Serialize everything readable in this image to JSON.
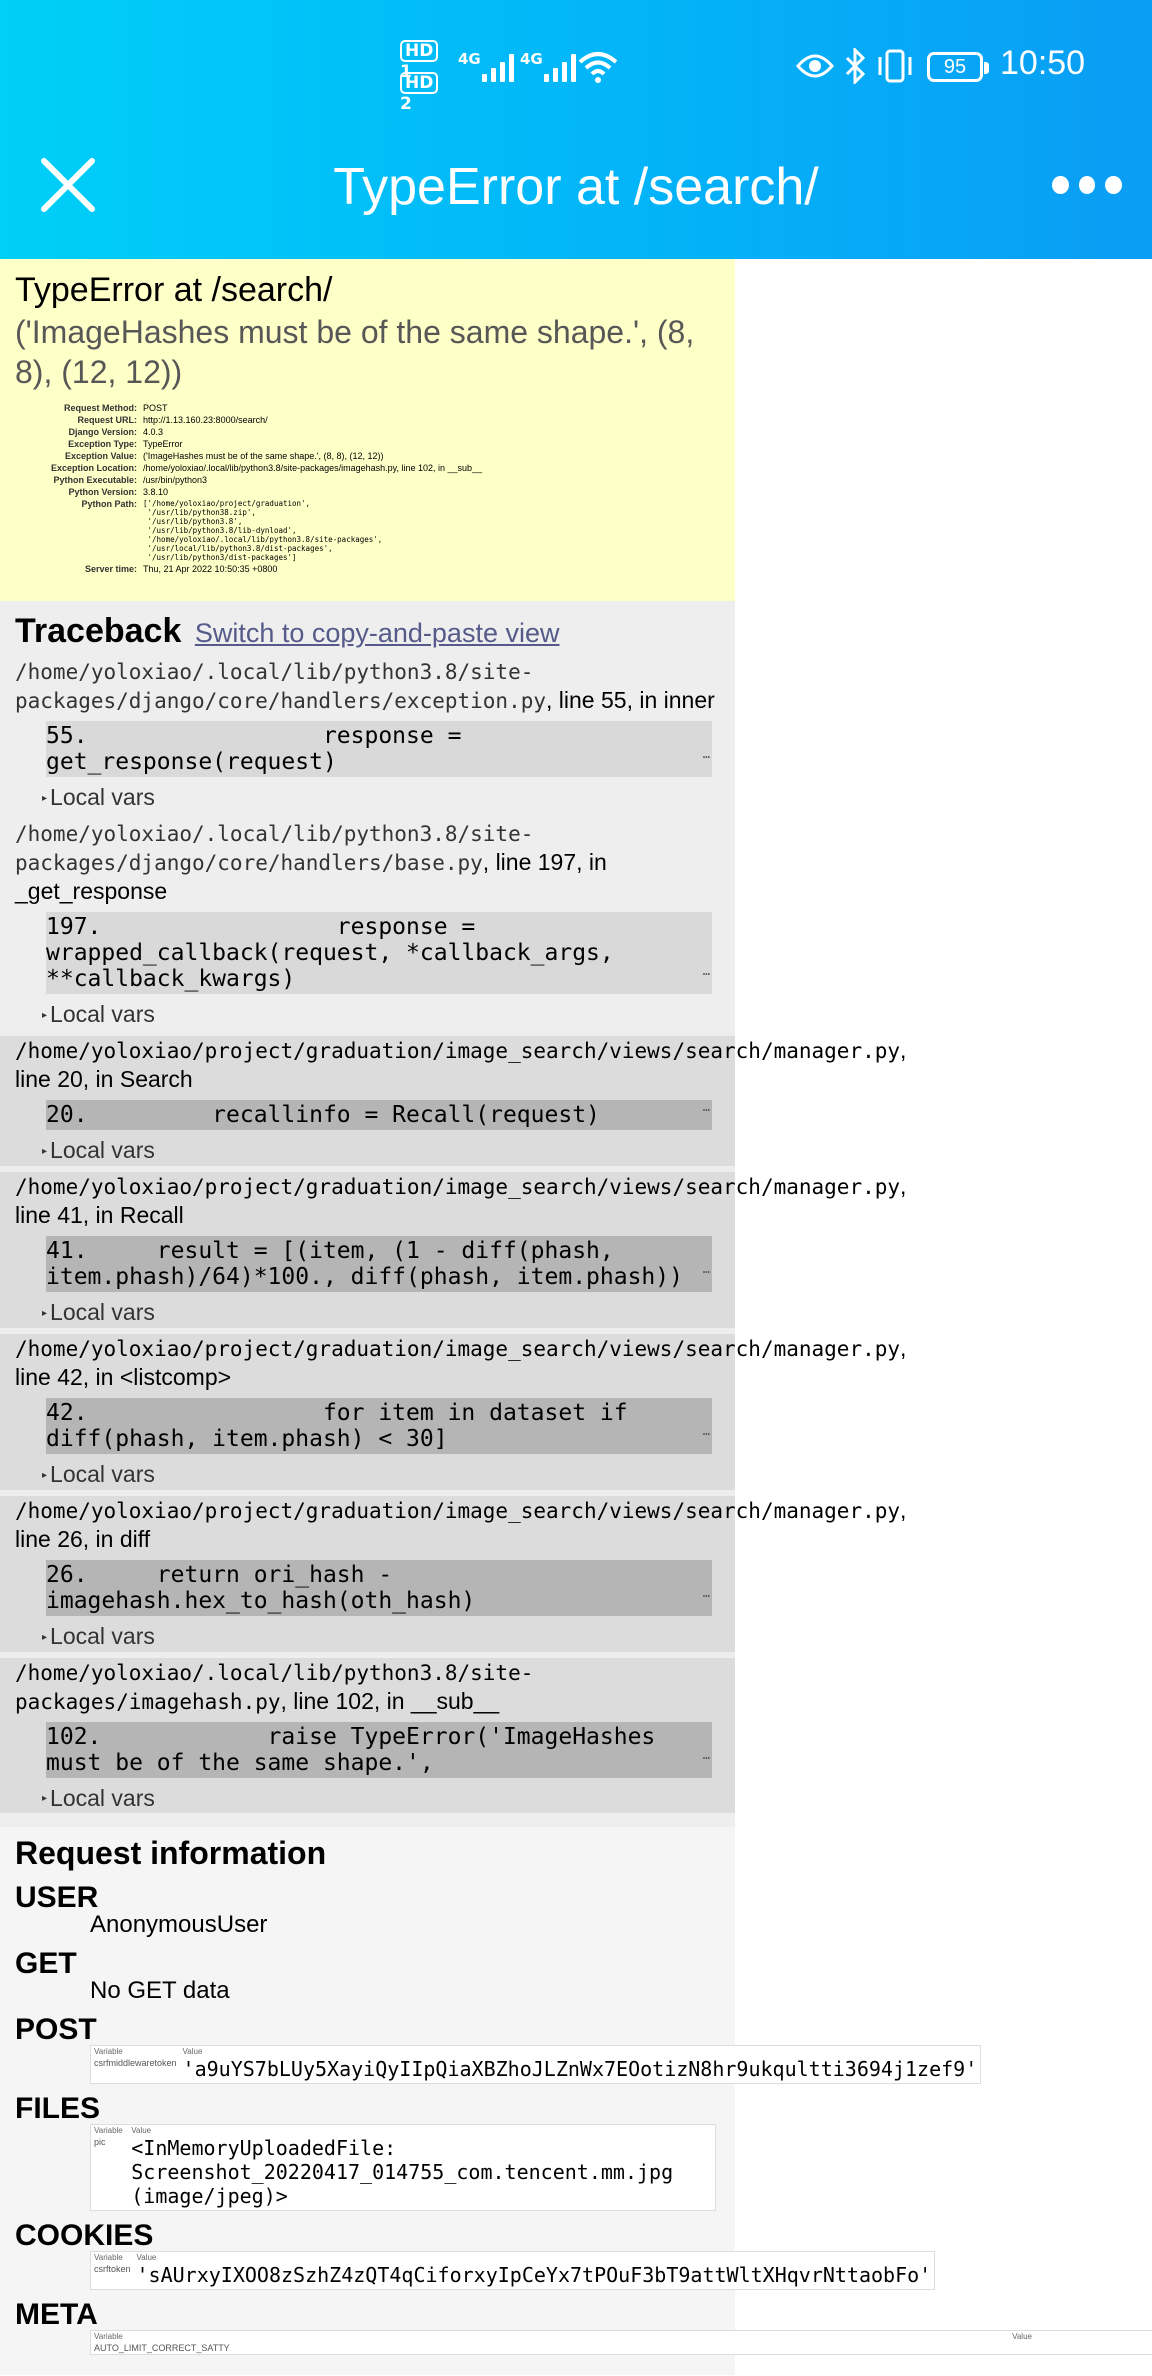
{
  "status_bar": {
    "sim1_badge": "HD",
    "sim1_num": "1",
    "sim2_badge": "HD",
    "sim2_num": "2",
    "net1": "4G",
    "net2": "4G",
    "battery": "95",
    "time": "10:50"
  },
  "nav": {
    "title": "TypeError at /search/"
  },
  "error": {
    "title": "TypeError at /search/",
    "message": "('ImageHashes must be of the same shape.', (8, 8), (12, 12))",
    "meta": [
      {
        "label": "Request Method:",
        "value": "POST"
      },
      {
        "label": "Request URL:",
        "value": "http://1.13.160.23:8000/search/"
      },
      {
        "label": "Django Version:",
        "value": "4.0.3"
      },
      {
        "label": "Exception Type:",
        "value": "TypeError"
      },
      {
        "label": "Exception Value:",
        "value": "('ImageHashes must be of the same shape.', (8, 8), (12, 12))"
      },
      {
        "label": "Exception Location:",
        "value": "/home/yoloxiao/.local/lib/python3.8/site-packages/imagehash.py, line 102, in __sub__"
      },
      {
        "label": "Python Executable:",
        "value": "/usr/bin/python3"
      },
      {
        "label": "Python Version:",
        "value": "3.8.10"
      },
      {
        "label": "Python Path:",
        "value": "['/home/yoloxiao/project/graduation',\n '/usr/lib/python38.zip',\n '/usr/lib/python3.8',\n '/usr/lib/python3.8/lib-dynload',\n '/home/yoloxiao/.local/lib/python3.8/site-packages',\n '/usr/local/lib/python3.8/dist-packages',\n '/usr/lib/python3/dist-packages']"
      },
      {
        "label": "Server time:",
        "value": "Thu, 21 Apr 2022 10:50:35 +0800"
      }
    ]
  },
  "traceback": {
    "heading": "Traceback",
    "switch_link": "Switch to copy-and-paste view",
    "local_vars_label": "Local vars",
    "frames": [
      {
        "path": "/home/yoloxiao/.local/lib/python3.8/site-packages/django/core/handlers/exception.py",
        "loc": ", line 55, in inner",
        "code": "55.                 response = get_response(request)",
        "user": false
      },
      {
        "path": "/home/yoloxiao/.local/lib/python3.8/site-packages/django/core/handlers/base.py",
        "loc": ", line 197, in _get_response",
        "code": "197.                 response = wrapped_callback(request, *callback_args, **callback_kwargs)",
        "user": false
      },
      {
        "path": "/home/yoloxiao/project/graduation/image_search/views/search/manager.py",
        "loc": ", line 20, in Search",
        "code": "20.         recallinfo = Recall(request)",
        "user": true
      },
      {
        "path": "/home/yoloxiao/project/graduation/image_search/views/search/manager.py",
        "loc": ", line 41, in Recall",
        "code": "41.     result = [(item, (1 - diff(phash, item.phash)/64)*100., diff(phash, item.phash))",
        "user": true
      },
      {
        "path": "/home/yoloxiao/project/graduation/image_search/views/search/manager.py",
        "loc": ", line 42, in <listcomp>",
        "code": "42.                 for item in dataset if diff(phash, item.phash) < 30]",
        "user": true
      },
      {
        "path": "/home/yoloxiao/project/graduation/image_search/views/search/manager.py",
        "loc": ", line 26, in diff",
        "code": "26.     return ori_hash - imagehash.hex_to_hash(oth_hash)",
        "user": true
      },
      {
        "path": "/home/yoloxiao/.local/lib/python3.8/site-packages/imagehash.py",
        "loc": ", line 102, in __sub__",
        "code": "102.            raise TypeError('ImageHashes must be of the same shape.',",
        "user": true
      }
    ]
  },
  "request_info": {
    "heading": "Request information",
    "user_heading": "USER",
    "user_value": "AnonymousUser",
    "get_heading": "GET",
    "get_value": "No GET data",
    "post_heading": "POST",
    "variable_col": "Variable",
    "value_col": "Value",
    "post_var": "csrfmiddlewaretoken",
    "post_val": "'a9uYS7bLUy5XayiQyIIpQiaXBZhoJLZnWx7EOotizN8hr9ukqultti3694j1zef9'",
    "files_heading": "FILES",
    "files_var": "pic",
    "files_val": "<InMemoryUploadedFile:\nScreenshot_20220417_014755_com.tencent.mm.jpg\n(image/jpeg)>",
    "cookies_heading": "COOKIES",
    "cookies_var": "csrftoken",
    "cookies_val": "'sAUrxyIXOO8zSzhZ4zQT4qCiforxyIpCeYx7tPOuF3bT9attWltXHqvrNttaobFo'",
    "meta_heading": "META",
    "meta_var_first": "AUTO_LIMIT_CORRECT_SATTY"
  }
}
